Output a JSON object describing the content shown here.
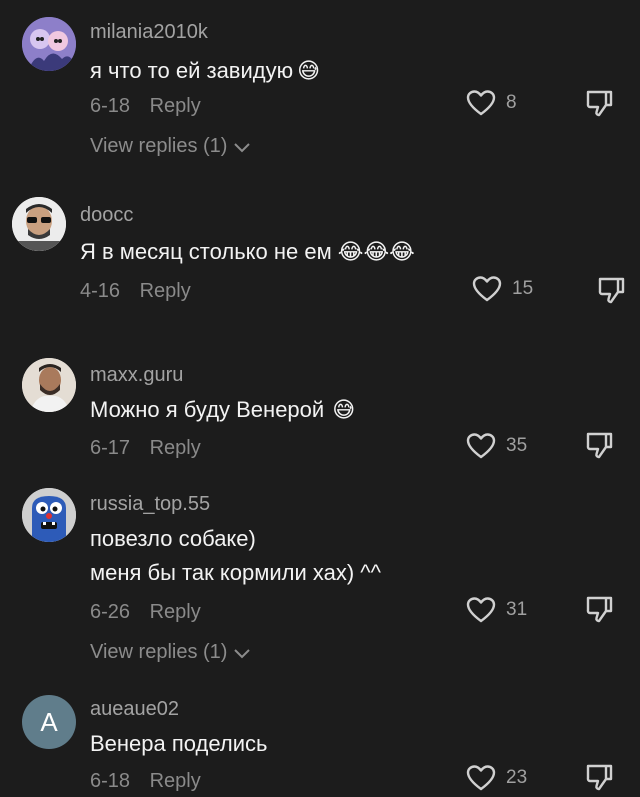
{
  "comments": [
    {
      "username": "milania2010k",
      "text_lines": [
        "я что то ей завидую"
      ],
      "emoji": "😅",
      "date": "6-18",
      "reply_label": "Reply",
      "likes": "8",
      "view_replies": "View replies (1)",
      "avatar_icon": "anime-avatar-icon"
    },
    {
      "username": "doocc",
      "text_lines": [
        "Я в месяц столько не ем"
      ],
      "emoji": "😂😂😂",
      "date": "4-16",
      "reply_label": "Reply",
      "likes": "15",
      "avatar_icon": "person-sunglasses-avatar-icon"
    },
    {
      "username": "maxx.guru",
      "text_lines": [
        "Можно я буду Венерой"
      ],
      "emoji": "😅",
      "date": "6-17",
      "reply_label": "Reply",
      "likes": "35",
      "avatar_icon": "person-avatar-icon"
    },
    {
      "username": "russia_top.55",
      "text_lines": [
        "повезло собаке)",
        "меня бы так кормили хах) ^^"
      ],
      "date": "6-26",
      "reply_label": "Reply",
      "likes": "31",
      "view_replies": "View replies (1)",
      "avatar_icon": "blue-monster-avatar-icon"
    },
    {
      "username": "aueaue02",
      "text_lines": [
        "Венера поделись"
      ],
      "date": "6-18",
      "reply_label": "Reply",
      "likes": "23",
      "avatar_letter": "A",
      "avatar_icon": "letter-avatar"
    }
  ],
  "colors": {
    "background": "#1c1c1c",
    "username": "#a3a3a3",
    "text": "#f3f3f3",
    "meta": "#8a8a8a",
    "letter_avatar_bg": "#607d8b"
  }
}
